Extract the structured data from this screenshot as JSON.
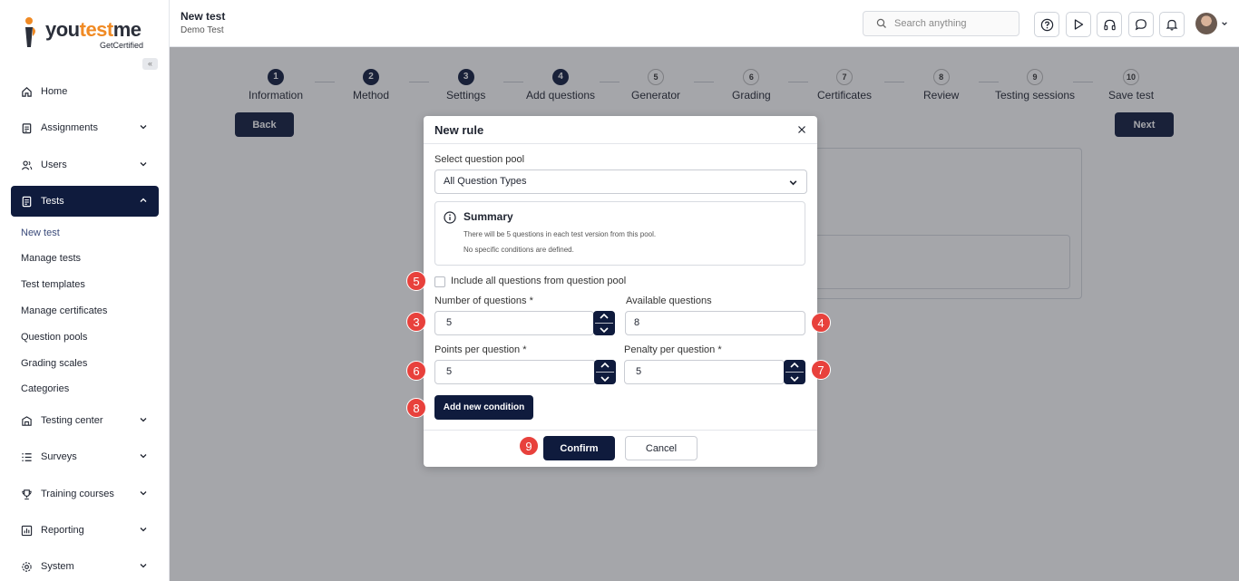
{
  "sidebar": {
    "logo_main_1": "you",
    "logo_main_2": "test",
    "logo_main_3": "me",
    "logo_sub": "GetCertified",
    "collapse_icon": "«",
    "items": [
      {
        "label": "Home",
        "icon": "home-icon"
      },
      {
        "label": "Assignments",
        "icon": "clipboard-icon"
      },
      {
        "label": "Users",
        "icon": "users-icon"
      },
      {
        "label": "Tests",
        "icon": "document-icon"
      },
      {
        "label": "Testing center",
        "icon": "testing-center-icon"
      },
      {
        "label": "Surveys",
        "icon": "list-icon"
      },
      {
        "label": "Training courses",
        "icon": "trophy-icon"
      },
      {
        "label": "Reporting",
        "icon": "chart-icon"
      },
      {
        "label": "System",
        "icon": "gear-icon"
      }
    ],
    "tests_sub": [
      "New test",
      "Manage tests",
      "Test templates",
      "Manage certificates",
      "Question pools",
      "Grading scales",
      "Categories"
    ]
  },
  "header": {
    "title": "New test",
    "subtitle": "Demo Test",
    "search_placeholder": "Search anything"
  },
  "wizard": {
    "steps": [
      {
        "num": "1",
        "label": "Information"
      },
      {
        "num": "2",
        "label": "Method"
      },
      {
        "num": "3",
        "label": "Settings"
      },
      {
        "num": "4",
        "label": "Add questions"
      },
      {
        "num": "5",
        "label": "Generator"
      },
      {
        "num": "6",
        "label": "Grading"
      },
      {
        "num": "7",
        "label": "Certificates"
      },
      {
        "num": "8",
        "label": "Review"
      },
      {
        "num": "9",
        "label": "Testing sessions"
      },
      {
        "num": "10",
        "label": "Save test"
      }
    ],
    "back_label": "Back",
    "next_label": "Next"
  },
  "modal": {
    "title": "New rule",
    "pool_label": "Select question pool",
    "pool_value": "All Question Types",
    "summary_title": "Summary",
    "summary_line1": "There will be 5 questions in each test version from this pool.",
    "summary_line2": "No specific conditions are defined.",
    "include_all_label": "Include all questions from question pool",
    "num_questions_label": "Number of questions",
    "num_questions_value": "5",
    "available_label": "Available questions",
    "available_value": "8",
    "points_label": "Points per question",
    "points_value": "5",
    "penalty_label": "Penalty per question",
    "penalty_value": "5",
    "required_mark": "*",
    "add_condition_label": "Add new condition",
    "confirm_label": "Confirm",
    "cancel_label": "Cancel"
  },
  "badges": [
    "3",
    "4",
    "5",
    "6",
    "7",
    "8",
    "9"
  ],
  "colors": {
    "primary": "#0f1b3d",
    "badge": "#e8413c",
    "logo_orange": "#f08a24"
  }
}
